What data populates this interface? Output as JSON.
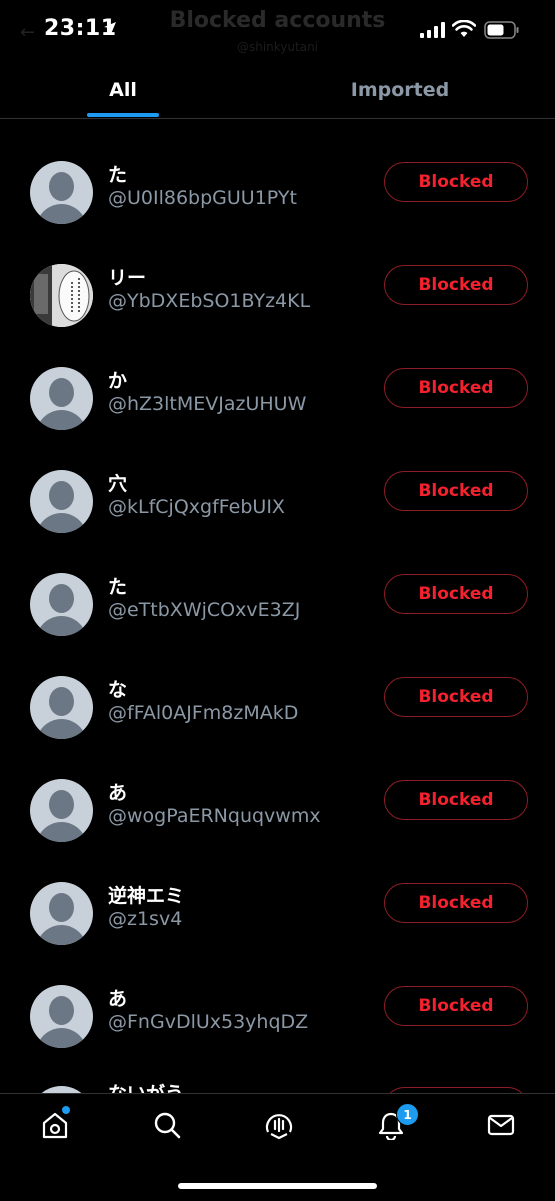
{
  "status_bar": {
    "time": "23:11"
  },
  "header": {
    "title": "Blocked accounts",
    "subtitle": "@shinkyutani"
  },
  "tabs": [
    {
      "label": "All",
      "selected": true
    },
    {
      "label": "Imported",
      "selected": false
    }
  ],
  "accounts": [
    {
      "name": "た",
      "handle": "@U0Il86bpGUU1PYt",
      "button": "Blocked",
      "avatar": "default-avatar"
    },
    {
      "name": "リー",
      "handle": "@YbDXEbSO1BYz4KL",
      "button": "Blocked",
      "avatar": "manga-avatar"
    },
    {
      "name": "か",
      "handle": "@hZ3ltMEVJazUHUW",
      "button": "Blocked",
      "avatar": "default-avatar"
    },
    {
      "name": "穴",
      "handle": "@kLfCjQxgfFebUIX",
      "button": "Blocked",
      "avatar": "default-avatar"
    },
    {
      "name": "た",
      "handle": "@eTtbXWjCOxvE3ZJ",
      "button": "Blocked",
      "avatar": "default-avatar"
    },
    {
      "name": "な",
      "handle": "@fFAl0AJFm8zMAkD",
      "button": "Blocked",
      "avatar": "default-avatar"
    },
    {
      "name": "あ",
      "handle": "@wogPaERNquqvwmx",
      "button": "Blocked",
      "avatar": "default-avatar"
    },
    {
      "name": "逆神エミ",
      "handle": "@z1sv4",
      "button": "Blocked",
      "avatar": "default-avatar"
    },
    {
      "name": "あ",
      "handle": "@FnGvDlUx53yhqDZ",
      "button": "Blocked",
      "avatar": "default-avatar"
    }
  ],
  "partial_account": {
    "name": "ないがう"
  },
  "bottom_nav": {
    "items": [
      "home-icon",
      "search-icon",
      "spaces-icon",
      "notifications-icon",
      "messages-icon"
    ],
    "notification_count": "1"
  },
  "colors": {
    "accent": "#1d9bf0",
    "blocked": "#f4212e",
    "muted": "#8b98a5"
  }
}
